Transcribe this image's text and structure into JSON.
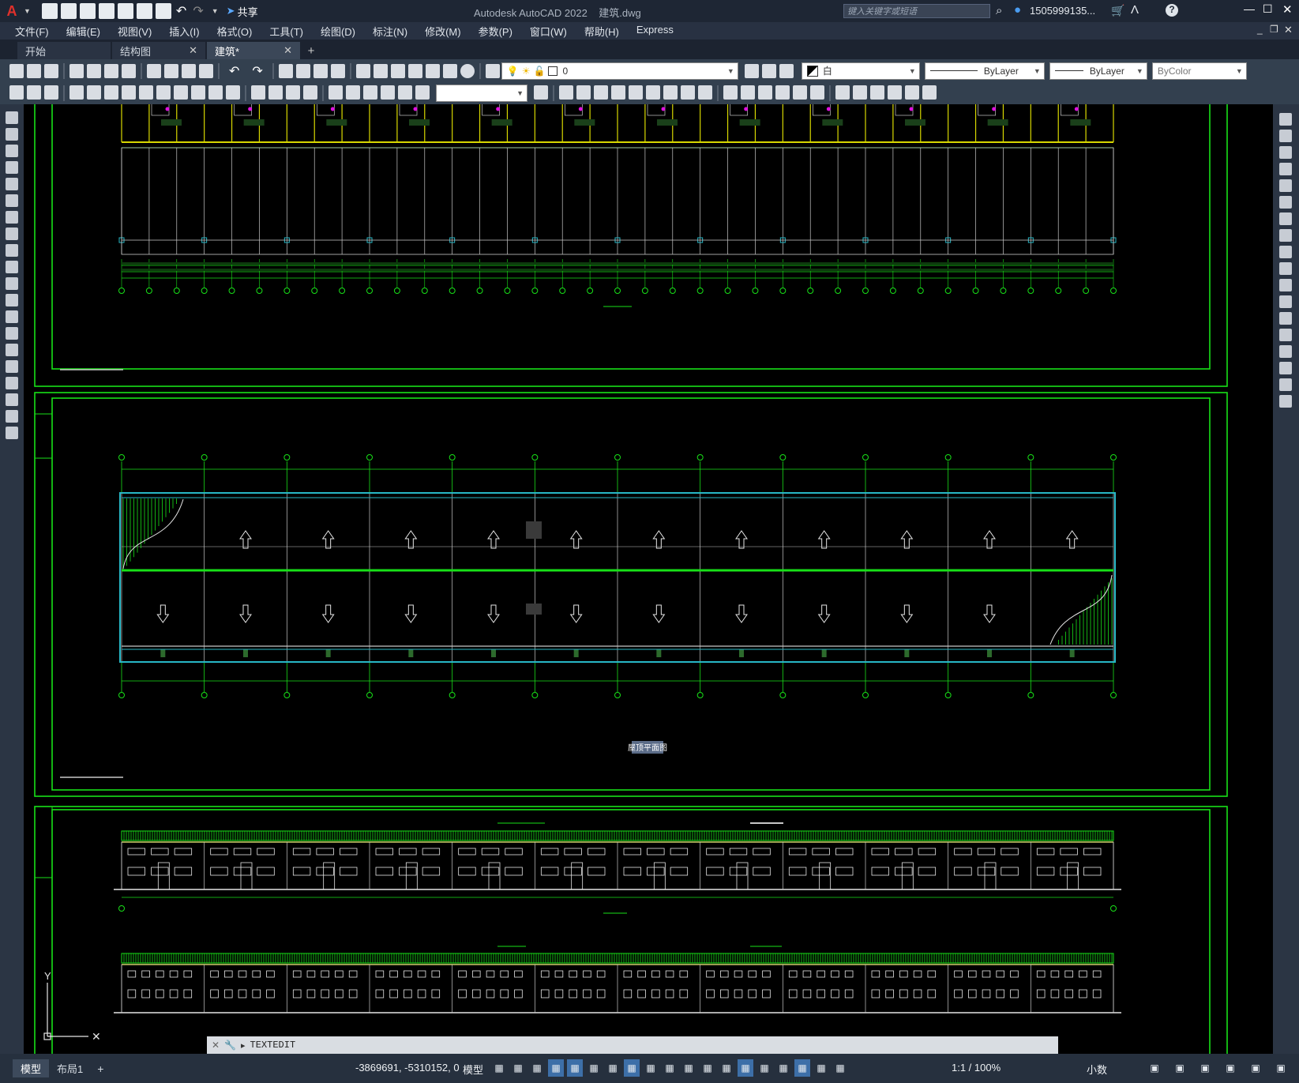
{
  "titlebar": {
    "app_icon": "A",
    "share_label": "共享",
    "title": "Autodesk AutoCAD 2022    建筑.dwg",
    "search_placeholder": "键入关键字或短语",
    "user": "1505999135...",
    "help": "?"
  },
  "menu": [
    "文件(F)",
    "编辑(E)",
    "视图(V)",
    "插入(I)",
    "格式(O)",
    "工具(T)",
    "绘图(D)",
    "标注(N)",
    "修改(M)",
    "参数(P)",
    "窗口(W)",
    "帮助(H)",
    "Express"
  ],
  "tabs": [
    {
      "label": "开始",
      "closable": false
    },
    {
      "label": "结构图",
      "closable": true
    },
    {
      "label": "建筑*",
      "closable": true,
      "active": true
    }
  ],
  "toolbar": {
    "layer_value": "0",
    "color_value": "白",
    "linetype_value": "ByLayer",
    "lineweight_value": "ByLayer",
    "plotstyle_value": "ByColor"
  },
  "drawing": {
    "axis_labels_top": [
      "①",
      "②",
      "③",
      "④",
      "⑤",
      "⑥",
      "⑦",
      "⑧",
      "⑨",
      "⑩",
      "⑪",
      "⑫",
      "⑬",
      "⑭",
      "⑮",
      "⑯",
      "⑰",
      "⑱",
      "⑲",
      "⑳",
      "㉑",
      "㉒",
      "㉓",
      "㉔",
      "㉕",
      "㉖",
      "㉗",
      "㉘",
      "㉙",
      "㉚",
      "㉛",
      "㉜",
      "㉝",
      "㉞",
      "㉟",
      "㊱",
      "㊲"
    ],
    "roof_plan_title": "屋顶平面图",
    "bottom_axis": "㊲"
  },
  "command": {
    "text": "TEXTEDIT"
  },
  "status": {
    "layout_tabs": [
      "模型",
      "布局1"
    ],
    "coords": "-3869691, -5310152, 0",
    "model_label": "模型",
    "scale": "1:1 / 100%",
    "units": "小数"
  },
  "colors": {
    "frame_green": "#18e018",
    "cyan": "#27b7c6",
    "grid_white": "#c8c8c8",
    "ui_dark": "#2b3544"
  }
}
